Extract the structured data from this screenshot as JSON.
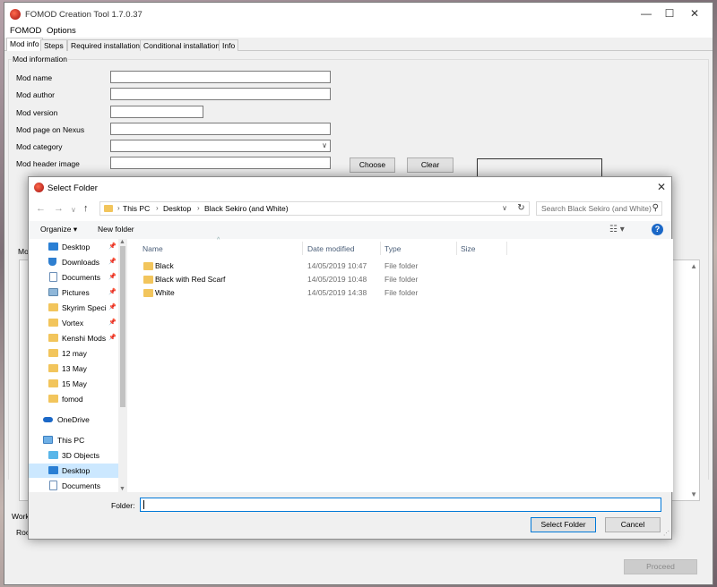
{
  "app": {
    "title": "FOMOD Creation Tool 1.7.0.37",
    "window_controls": {
      "minimize": "—",
      "maximize": "☐",
      "close": "✕"
    },
    "menu": [
      "FOMOD",
      "Options"
    ],
    "tabs": [
      "Mod info",
      "Steps",
      "Required installations",
      "Conditional installations",
      "Info"
    ],
    "group_title": "Mod information",
    "fields": {
      "mod_name": "Mod name",
      "mod_author": "Mod author",
      "mod_version": "Mod version",
      "mod_page": "Mod page on Nexus",
      "mod_category": "Mod category",
      "mod_header_image": "Mod header image"
    },
    "buttons": {
      "choose": "Choose",
      "clear": "Clear",
      "proceed": "Proceed"
    },
    "partial_labels": {
      "mod": "Mod",
      "work": "Work",
      "root": "Roo"
    }
  },
  "dialog": {
    "title": "Select Folder",
    "close": "✕",
    "nav": {
      "back": "←",
      "forward": "→",
      "recent": "∨",
      "up": "↑",
      "refresh": "↻",
      "dropdown": "∨"
    },
    "breadcrumb": [
      "This PC",
      "Desktop",
      "Black Sekiro (and White)"
    ],
    "search_placeholder": "Search Black Sekiro (and White)",
    "search_glyph": "⚲",
    "commands": {
      "organize": "Organize ▾",
      "new_folder": "New folder"
    },
    "view_glyph": "☷ ▾",
    "help_glyph": "?",
    "columns": [
      "Name",
      "Date modified",
      "Type",
      "Size"
    ],
    "files": [
      {
        "name": "Black",
        "date": "14/05/2019 10:47",
        "type": "File folder"
      },
      {
        "name": "Black with Red Scarf",
        "date": "14/05/2019 10:48",
        "type": "File folder"
      },
      {
        "name": "White",
        "date": "14/05/2019 14:38",
        "type": "File folder"
      }
    ],
    "nav_items": [
      {
        "label": "Desktop",
        "pinned": true
      },
      {
        "label": "Downloads",
        "pinned": true
      },
      {
        "label": "Documents",
        "pinned": true
      },
      {
        "label": "Pictures",
        "pinned": true
      },
      {
        "label": "Skyrim Speci",
        "pinned": true
      },
      {
        "label": "Vortex",
        "pinned": true
      },
      {
        "label": "Kenshi Mods",
        "pinned": true
      },
      {
        "label": "12 may",
        "pinned": false
      },
      {
        "label": "13 May",
        "pinned": false
      },
      {
        "label": "15 May",
        "pinned": false
      },
      {
        "label": "fomod",
        "pinned": false
      },
      {
        "label": "OneDrive",
        "pinned": false
      },
      {
        "label": "This PC",
        "pinned": false
      },
      {
        "label": "3D Objects",
        "pinned": false
      },
      {
        "label": "Desktop",
        "pinned": false
      },
      {
        "label": "Documents",
        "pinned": false
      }
    ],
    "pin_glyph": "📌",
    "folder_label": "Folder:",
    "folder_value": "",
    "buttons": {
      "select": "Select Folder",
      "cancel": "Cancel"
    }
  },
  "colors": {
    "accent": "#0078d7",
    "selection": "#cce8ff",
    "folder": "#f2c55c",
    "help": "#1b68c7"
  }
}
